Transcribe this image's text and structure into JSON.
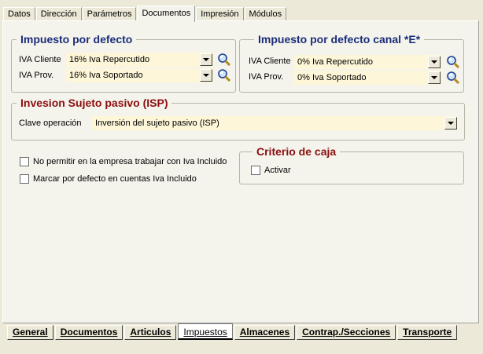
{
  "top_tabs": [
    "Datos",
    "Dirección",
    "Parámetros",
    "Documentos",
    "Impresión",
    "Módulos"
  ],
  "active_top_tab": "Documentos",
  "impuesto_defecto": {
    "title": "Impuesto por defecto",
    "iva_cliente_label": "IVA Cliente",
    "iva_cliente_value": "16% Iva Repercutido",
    "iva_prov_label": "IVA Prov.",
    "iva_prov_value": "16% Iva Soportado"
  },
  "impuesto_canal": {
    "title": "Impuesto por defecto canal *E*",
    "iva_cliente_label": "IVA Cliente",
    "iva_cliente_value": "0% Iva Repercutido",
    "iva_prov_label": "IVA Prov.",
    "iva_prov_value": "0% Iva Soportado"
  },
  "isp": {
    "title": "Invesion Sujeto pasivo (ISP)",
    "clave_label": "Clave operación",
    "clave_value": "Inversión del sujeto pasivo (ISP)"
  },
  "checks": {
    "no_permitir": "No permitir en la empresa trabajar con Iva Incluido",
    "marcar_defecto": "Marcar por defecto en cuentas Iva Incluido"
  },
  "criterio_caja": {
    "title": "Criterio de caja",
    "activar": "Activar"
  },
  "bottom_tabs": [
    "General",
    "Documentos",
    "Articulos",
    "Impuestos",
    "Almacenes",
    "Contrap./Secciones",
    "Transporte"
  ],
  "active_bottom_tab": "Impuestos",
  "colors": {
    "title_blue": "#1a2d7a",
    "title_red": "#8b0e0e",
    "combo_bg": "#fdf6d8"
  }
}
